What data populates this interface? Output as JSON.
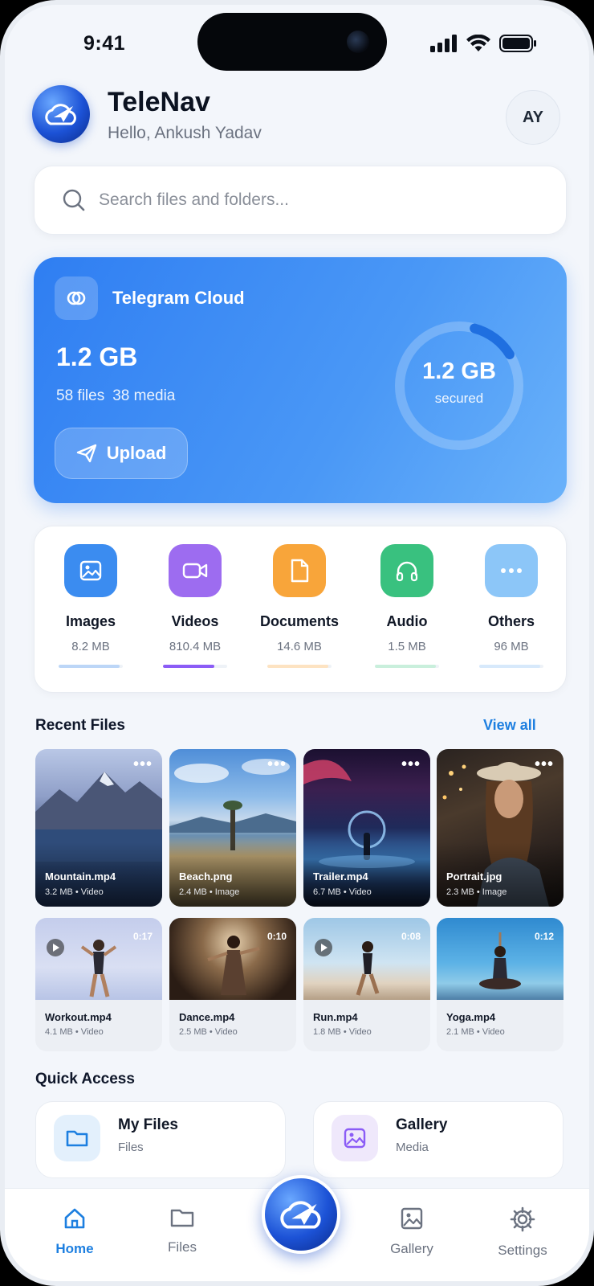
{
  "status": {
    "time": "9:41"
  },
  "header": {
    "title": "TeleNav",
    "greeting": "Hello, Ankush Yadav",
    "avatar_initials": "AY"
  },
  "search": {
    "placeholder": "Search files and folders..."
  },
  "cloud": {
    "title": "Telegram Cloud",
    "size": "1.2 GB",
    "files": "58 files",
    "media": "38 media",
    "upload_label": "Upload",
    "ring_value": "1.2 GB",
    "ring_label": "secured",
    "ring_fraction": 0.12
  },
  "categories": [
    {
      "name": "Images",
      "size": "8.2 MB",
      "icon": "image-icon",
      "color": "#3b8cf0",
      "fill": 0.95,
      "bar": "#bcd6f7"
    },
    {
      "name": "Videos",
      "size": "810.4 MB",
      "icon": "video-icon",
      "color": "#9d6cf0",
      "fill": 0.8,
      "bar": "#8b5cf6"
    },
    {
      "name": "Documents",
      "size": "14.6 MB",
      "icon": "document-icon",
      "color": "#f8a53a",
      "fill": 0.95,
      "bar": "#fde3c2"
    },
    {
      "name": "Audio",
      "size": "1.5 MB",
      "icon": "headphones-icon",
      "color": "#39c17f",
      "fill": 0.95,
      "bar": "#c9efdc"
    },
    {
      "name": "Others",
      "size": "96 MB",
      "icon": "more-icon",
      "color": "#8cc6f8",
      "fill": 0.95,
      "bar": "#d7e9fb"
    }
  ],
  "recent": {
    "title": "Recent Files",
    "view_all": "View all",
    "tiles": [
      {
        "name": "Mountain.mp4",
        "meta": "3.2 MB • Video"
      },
      {
        "name": "Beach.png",
        "meta": "2.4 MB • Image"
      },
      {
        "name": "Trailer.mp4",
        "meta": "6.7 MB • Video"
      },
      {
        "name": "Portrait.jpg",
        "meta": "2.3 MB • Image"
      }
    ],
    "videos": [
      {
        "name": "Workout.mp4",
        "meta": "4.1 MB • Video",
        "duration": "0:17"
      },
      {
        "name": "Dance.mp4",
        "meta": "2.5 MB • Video",
        "duration": "0:10"
      },
      {
        "name": "Run.mp4",
        "meta": "1.8 MB • Video",
        "duration": "0:08"
      },
      {
        "name": "Yoga.mp4",
        "meta": "2.1 MB • Video",
        "duration": "0:12"
      }
    ]
  },
  "quick_access": {
    "title": "Quick Access",
    "items": [
      {
        "name": "My Files",
        "sub": "Files"
      },
      {
        "name": "Gallery",
        "sub": "Media"
      }
    ]
  },
  "nav": {
    "home": "Home",
    "files": "Files",
    "gallery": "Gallery",
    "settings": "Settings"
  },
  "colors": {
    "accent": "#1d7fe0",
    "card_blue": "#2f7ef2"
  }
}
